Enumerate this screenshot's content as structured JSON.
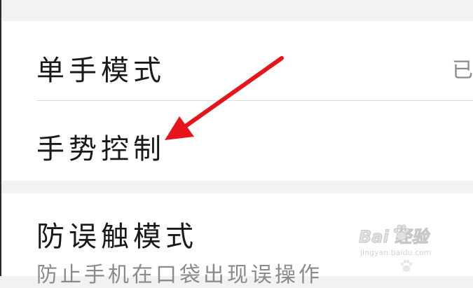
{
  "settings": {
    "items": [
      {
        "title": "单手模式",
        "value": "已"
      },
      {
        "title": "手势控制"
      },
      {
        "title": "防误触模式",
        "subtitle": "防止手机在口袋出现误操作"
      }
    ]
  },
  "annotation": {
    "arrow_color": "#e8141c"
  },
  "watermark": {
    "logo": "Bai  经验",
    "url": "jingyan.baidu.com"
  }
}
